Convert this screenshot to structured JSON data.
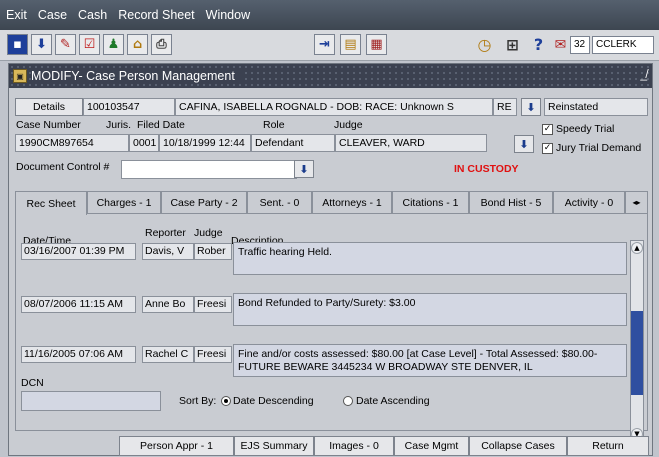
{
  "menu": [
    "Exit",
    "Case",
    "Cash",
    "Record Sheet",
    "Window"
  ],
  "toolbar": {
    "count_value": "32",
    "user_value": "CCLERK"
  },
  "window": {
    "title": "MODIFY- Case Person Management"
  },
  "header": {
    "details_label": "Details",
    "case_person_id": "100103547",
    "person_info": "CAFINA, ISABELLA ROGNALD - DOB:  RACE: Unknown  S",
    "status_code": "RE",
    "status_text": "Reinstated",
    "case_number_label": "Case Number",
    "juris_label": "Juris.",
    "filed_date_label": "Filed Date",
    "role_label": "Role",
    "judge_label": "Judge",
    "case_number": "1990CM897654",
    "juris": "0001",
    "filed_date": "10/18/1999 12:44",
    "role": "Defendant",
    "judge": "CLEAVER, WARD",
    "speedy_trial_label": "Speedy Trial",
    "jury_trial_label": "Jury Trial Demand",
    "doc_control_label": "Document Control #",
    "doc_control_value": "",
    "custody_status": "IN CUSTODY"
  },
  "tabs": [
    {
      "label": "Rec Sheet"
    },
    {
      "label": "Charges - 1"
    },
    {
      "label": "Case Party - 2"
    },
    {
      "label": "Sent. - 0"
    },
    {
      "label": "Attorneys - 1"
    },
    {
      "label": "Citations - 1"
    },
    {
      "label": "Bond Hist - 5"
    },
    {
      "label": "Activity - 0"
    }
  ],
  "records": {
    "col_datetime": "Date/Time",
    "col_reporter": "Reporter",
    "col_judge": "Judge",
    "col_description": "Description",
    "rows": [
      {
        "datetime": "03/16/2007 01:39 PM",
        "reporter": "Davis, V",
        "judge": "Rober",
        "description": "Traffic hearing Held."
      },
      {
        "datetime": "08/07/2006 11:15 AM",
        "reporter": "Anne Bo",
        "judge": "Freesi",
        "description": "Bond Refunded to Party/Surety: $3.00"
      },
      {
        "datetime": "11/16/2005 07:06 AM",
        "reporter": "Rachel C",
        "judge": "Freesi",
        "description": "Fine and/or costs assessed: $80.00 [at Case Level] - Total Assessed: $80.00- FUTURE BEWARE 3445234 W BROADWAY   STE  DENVER, IL"
      }
    ],
    "dcn_label": "DCN",
    "dcn_value": "",
    "sort_by_label": "Sort By:",
    "sort_desc_label": "Date Descending",
    "sort_asc_label": "Date Ascending"
  },
  "bottom_buttons": [
    {
      "label": "Person Appr - 1"
    },
    {
      "label": "EJS Summary"
    },
    {
      "label": "Images - 0"
    },
    {
      "label": "Case Mgmt"
    },
    {
      "label": "Collapse Cases"
    },
    {
      "label": "Return"
    }
  ],
  "colors": {
    "menubar": "#3d4651",
    "custody": "#e01010",
    "scroll_thumb": "#2f4fa0"
  }
}
